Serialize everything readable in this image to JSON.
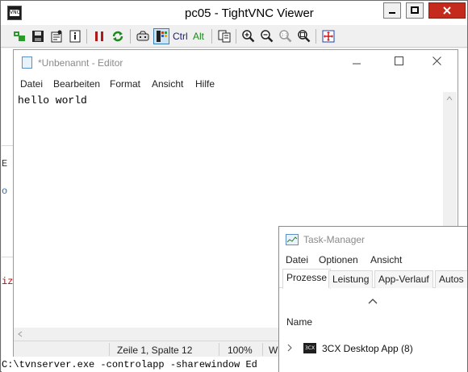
{
  "vnc": {
    "title": "pc05 - TightVNC Viewer",
    "toolbar": {
      "ctrl_label": "Ctrl",
      "alt_label": "Alt"
    }
  },
  "notepad": {
    "title": "*Unbenannt - Editor",
    "menu": [
      "Datei",
      "Bearbeiten",
      "Format",
      "Ansicht",
      "Hilfe"
    ],
    "content": "hello world",
    "status": {
      "position": "Zeile 1, Spalte 12",
      "zoom": "100%",
      "encoding_partial": "Wi"
    }
  },
  "taskmanager": {
    "title": "Task-Manager",
    "menu": [
      "Datei",
      "Optionen",
      "Ansicht"
    ],
    "tabs": [
      "Prozesse",
      "Leistung",
      "App-Verlauf",
      "Autos"
    ],
    "column_name": "Name",
    "process": {
      "icon_text": "3CX",
      "name": "3CX Desktop App (8)"
    }
  },
  "background": {
    "cmd_line": "C:\\tvnserver.exe  -controlapp -sharewindow Ed",
    "fragments": [
      "E",
      "o",
      "iz"
    ]
  },
  "colors": {
    "close_red": "#c42b1c",
    "tab_selected": "#ffffff",
    "accent_blue": "#3c7fb1",
    "bg_text_red": "#cc0000"
  }
}
